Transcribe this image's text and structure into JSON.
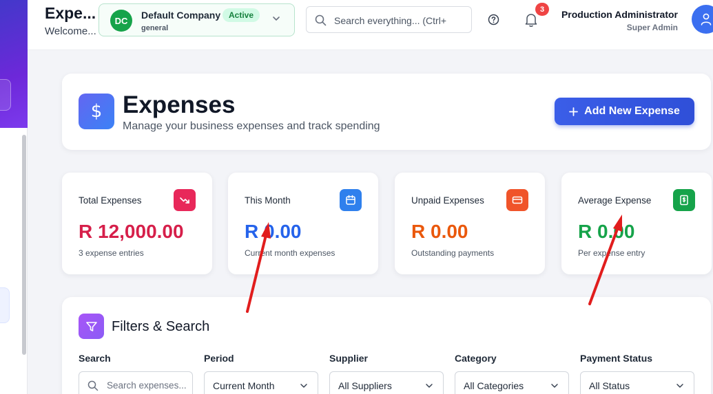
{
  "header": {
    "page_name": "Expe...",
    "welcome": "Welcome...",
    "company": {
      "initials": "DC",
      "name": "Default Company",
      "status": "Active",
      "sub": "general"
    },
    "search_placeholder": "Search everything... (Ctrl+",
    "notification_count": "3",
    "user_name": "Production Administrator",
    "user_role": "Super Admin"
  },
  "page": {
    "title": "Expenses",
    "subtitle": "Manage your business expenses and track spending",
    "add_button": "Add New Expense",
    "title_icon_glyph": "$"
  },
  "stats": [
    {
      "label": "Total Expenses",
      "value": "R 12,000.00",
      "sub": "3 expense entries",
      "color": "#d61f4a",
      "icon": "trending-down-icon",
      "icon_bg": "#e8285a"
    },
    {
      "label": "This Month",
      "value": "R 0.00",
      "sub": "Current month expenses",
      "color": "#2563eb",
      "icon": "calendar-icon",
      "icon_bg": "#2f80ed"
    },
    {
      "label": "Unpaid Expenses",
      "value": "R 0.00",
      "sub": "Outstanding payments",
      "color": "#ea580c",
      "icon": "credit-card-icon",
      "icon_bg": "#f0542a"
    },
    {
      "label": "Average Expense",
      "value": "R 0.00",
      "sub": "Per expense entry",
      "color": "#16a34a",
      "icon": "receipt-icon",
      "icon_bg": "#16a34a"
    }
  ],
  "filters": {
    "title": "Filters & Search",
    "fields": [
      {
        "label": "Search",
        "value": "Search expenses...",
        "type": "search"
      },
      {
        "label": "Period",
        "value": "Current Month",
        "type": "select"
      },
      {
        "label": "Supplier",
        "value": "All Suppliers",
        "type": "select"
      },
      {
        "label": "Category",
        "value": "All Categories",
        "type": "select"
      },
      {
        "label": "Payment Status",
        "value": "All Status",
        "type": "select"
      }
    ]
  },
  "colors": {
    "accent": "#3b5ee8",
    "annotation_arrow": "#e11d1d"
  }
}
